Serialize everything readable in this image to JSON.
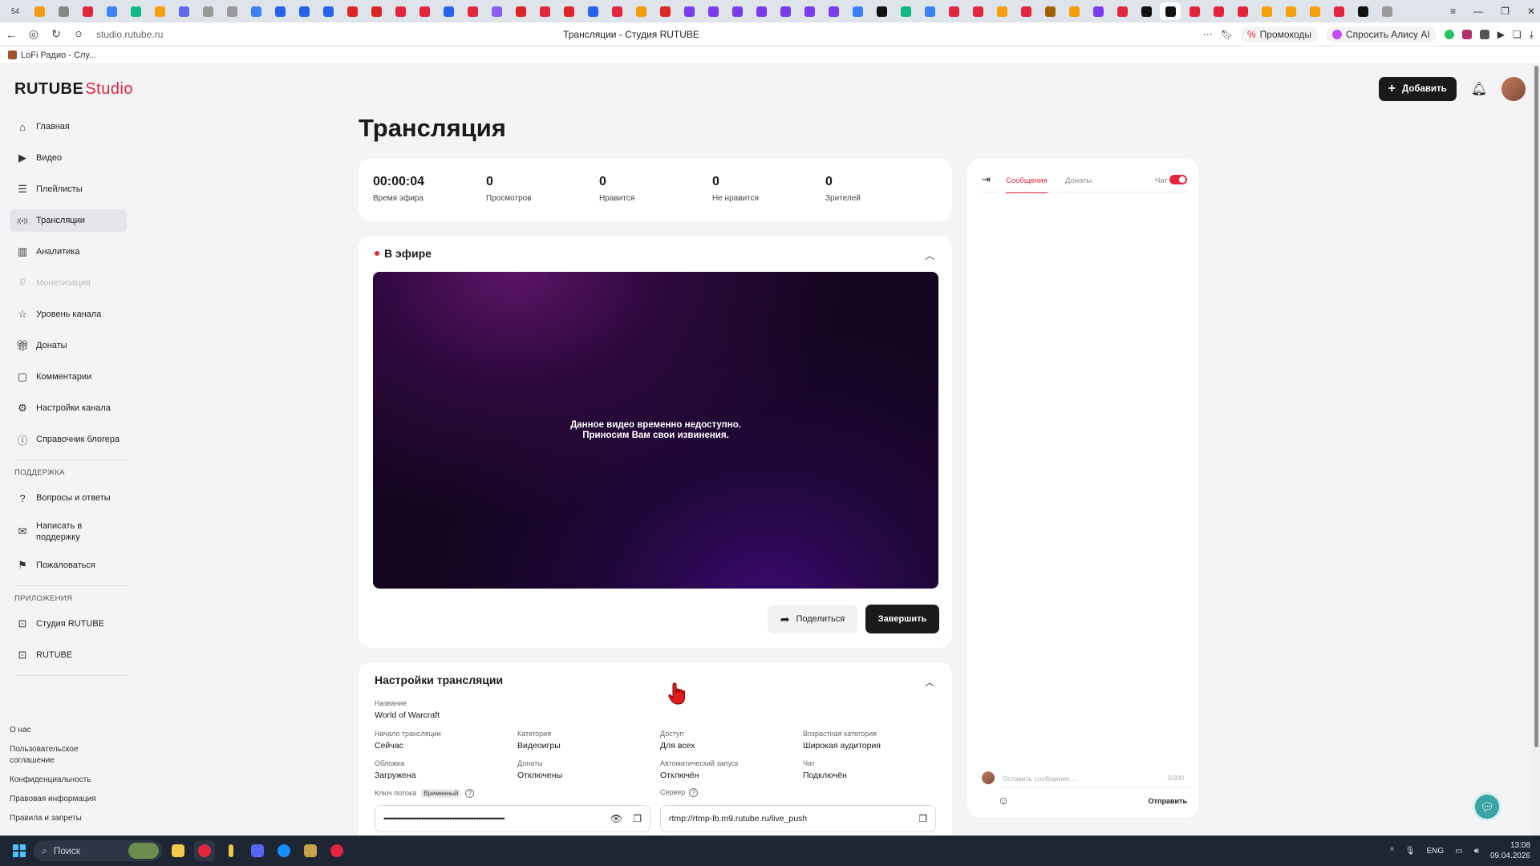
{
  "browser": {
    "tab_favicons": [
      "#f39c12",
      "#888",
      "#e3253e",
      "#3b82f6",
      "#10b981",
      "#f59e0b",
      "#6366f1",
      "#999",
      "#999",
      "#3b82f6",
      "#2563eb",
      "#2563eb",
      "#2563eb",
      "#dc2626",
      "#dc2626",
      "#e3253e",
      "#e3253e",
      "#2563eb",
      "#e3253e",
      "#8b5cf6",
      "#dc2626",
      "#e3253e",
      "#dc2626",
      "#2563eb",
      "#e3253e",
      "#f59e0b",
      "#dc2626",
      "#7c3aed",
      "#7c3aed",
      "#7c3aed",
      "#7c3aed",
      "#7c3aed",
      "#7c3aed",
      "#7c3aed",
      "#3b82f6",
      "#111",
      "#10b981",
      "#3b82f6",
      "#e3253e",
      "#e3253e",
      "#f59e0b",
      "#e3253e",
      "#a16207",
      "#f59e0b",
      "#7c3aed",
      "#e3253e",
      "#111",
      "#111",
      "#e3253e",
      "#e3253e",
      "#e3253e",
      "#f59e0b",
      "#f59e0b",
      "#f59e0b",
      "#e3253e",
      "#111",
      "#999"
    ],
    "tab_counter": "54",
    "url": "studio.rutube.ru",
    "page_title": "Трансляции - Студия RUTUBE",
    "promo_label": "Промокоды",
    "alice_label": "Спросить Алису AI",
    "bookmark": "LoFi Радио - Слу..."
  },
  "app": {
    "logo_main": "RUTUBE",
    "logo_studio": "Studio",
    "accent": "#e3253e",
    "add_label": "Добавить"
  },
  "sidebar": {
    "items": [
      {
        "label": "Главная",
        "icon": "home-icon"
      },
      {
        "label": "Видео",
        "icon": "video-icon"
      },
      {
        "label": "Плейлисты",
        "icon": "playlist-icon"
      },
      {
        "label": "Трансляции",
        "icon": "broadcast-icon"
      },
      {
        "label": "Аналитика",
        "icon": "analytics-icon"
      },
      {
        "label": "Монетизация",
        "icon": "money-icon"
      },
      {
        "label": "Уровень канала",
        "icon": "star-icon"
      },
      {
        "label": "Донаты",
        "icon": "gift-icon"
      },
      {
        "label": "Комментарии",
        "icon": "comment-icon"
      },
      {
        "label": "Настройки канала",
        "icon": "gear-icon"
      },
      {
        "label": "Справочник блогера",
        "icon": "info-icon"
      }
    ],
    "support_title": "ПОДДЕРЖКА",
    "support": [
      {
        "label": "Вопросы и ответы"
      },
      {
        "label": "Написать в поддержку"
      },
      {
        "label": "Пожаловаться"
      }
    ],
    "apps_title": "ПРИЛОЖЕНИЯ",
    "apps": [
      {
        "label": "Студия RUTUBE"
      },
      {
        "label": "RUTUBE"
      }
    ],
    "footer": [
      "О нас",
      "Пользовательское соглашение",
      "Конфиденциальность",
      "Правовая информация",
      "Правила и запреты"
    ]
  },
  "main": {
    "title": "Трансляция",
    "stats": [
      {
        "value": "00:00:04",
        "label": "Время эфира"
      },
      {
        "value": "0",
        "label": "Просмотров"
      },
      {
        "value": "0",
        "label": "Нравится"
      },
      {
        "value": "0",
        "label": "Не нравится"
      },
      {
        "value": "0",
        "label": "Зрителей"
      }
    ],
    "live_label": "В эфире",
    "player_msg_1": "Данное видео временно недоступно.",
    "player_msg_2": "Приносим Вам свои извинения.",
    "share_label": "Поделиться",
    "end_label": "Завершить"
  },
  "settings": {
    "title": "Настройки трансляции",
    "name_label": "Название",
    "name_value": "World of Warcraft",
    "start_label": "Начало трансляции",
    "start_value": "Сейчас",
    "category_label": "Категория",
    "category_value": "Видеоигры",
    "access_label": "Доступ",
    "access_value": "Для всех",
    "age_label": "Возрастная категория",
    "age_value": "Широкая аудитория",
    "cover_label": "Обложка",
    "cover_value": "Загружена",
    "donates_label": "Донаты",
    "donates_value": "Отключены",
    "autostart_label": "Автоматический запуск",
    "autostart_value": "Отключён",
    "chat_label": "Чат",
    "chat_value": "Подключён",
    "key_label": "Ключ потока",
    "key_tag": "Временный",
    "key_value": "••••••••••••••••••••••••••••••••••••••••••••••••••••••••••••••••••••••",
    "server_label": "Сервер",
    "server_value": "rtmp://rtmp-lb.m9.rutube.ru/live_push"
  },
  "chat": {
    "tab_messages": "Сообщения",
    "tab_donates": "Донаты",
    "chat_toggle_label": "Чат",
    "placeholder": "Оставить сообщение...",
    "counter": "0/200",
    "send_label": "Отправить"
  },
  "taskbar": {
    "search": "Поиск",
    "lang": "ENG",
    "time": "13:08",
    "date": "09.04.2026"
  }
}
